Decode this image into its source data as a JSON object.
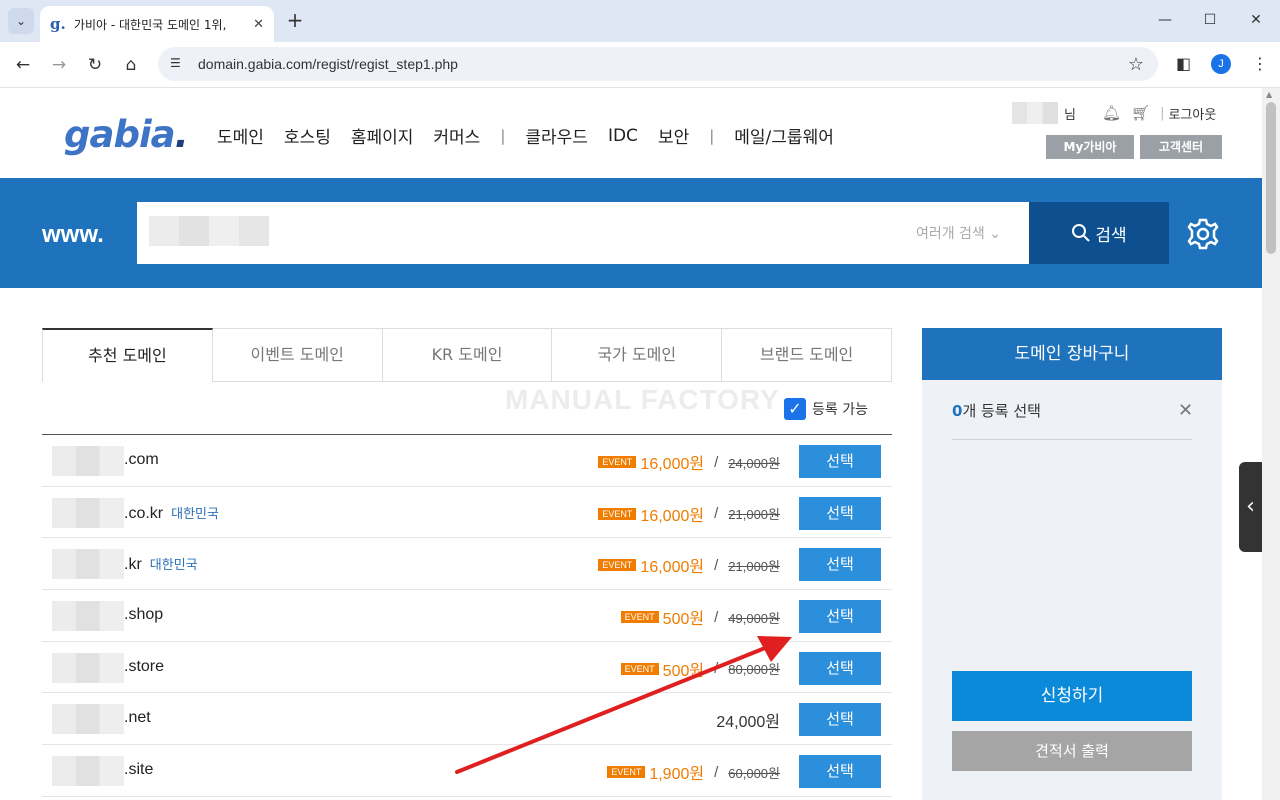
{
  "browser": {
    "tab_title": "가비아 - 대한민국 도메인 1위,",
    "url": "domain.gabia.com/regist/regist_step1.php",
    "profile_initial": "J"
  },
  "header": {
    "logo": "gabia",
    "nav": [
      "도메인",
      "호스팅",
      "홈페이지",
      "커머스",
      "클라우드",
      "IDC",
      "보안",
      "메일/그룹웨어"
    ],
    "user_suffix": "님",
    "logout": "로그아웃",
    "my_gabia": "My가비아",
    "support": "고객센터"
  },
  "search": {
    "prefix": "www.",
    "multi_search": "여러개 검색",
    "button": "검색"
  },
  "tabs": [
    "추천 도메인",
    "이벤트 도메인",
    "KR 도메인",
    "국가 도메인",
    "브랜드 도메인"
  ],
  "watermark": "MANUAL FACTORY",
  "filter_label": "등록 가능",
  "event_badge": "EVENT",
  "select_label": "선택",
  "domains": [
    {
      "ext": ".com",
      "tag": "",
      "price": "16,000원",
      "old": "24,000원",
      "event": true
    },
    {
      "ext": ".co.kr",
      "tag": "대한민국",
      "price": "16,000원",
      "old": "21,000원",
      "event": true
    },
    {
      "ext": ".kr",
      "tag": "대한민국",
      "price": "16,000원",
      "old": "21,000원",
      "event": true
    },
    {
      "ext": ".shop",
      "tag": "",
      "price": "500원",
      "old": "49,000원",
      "event": true
    },
    {
      "ext": ".store",
      "tag": "",
      "price": "500원",
      "old": "80,000원",
      "event": true
    },
    {
      "ext": ".net",
      "tag": "",
      "price": "24,000원",
      "old": "",
      "event": false
    },
    {
      "ext": ".site",
      "tag": "",
      "price": "1,900원",
      "old": "60,000원",
      "event": true
    }
  ],
  "cart": {
    "title": "도메인 장바구니",
    "count": "0",
    "count_suffix": "개 등록 선택",
    "apply": "신청하기",
    "estimate": "견적서 출력"
  },
  "colors": {
    "brand_blue": "#1f73bd",
    "event_orange": "#f07c00",
    "select_blue": "#2b8fdc",
    "annotation_red": "#e02020"
  }
}
